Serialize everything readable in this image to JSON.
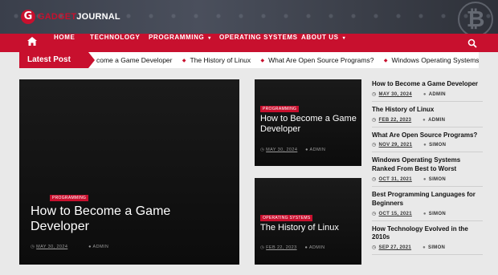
{
  "site": {
    "logo_letter": "G",
    "logo_brand_red": "GADGET",
    "logo_brand_white": "JOURNAL",
    "accent": "#c8102e"
  },
  "nav": {
    "home_icon": "home-icon",
    "items": [
      {
        "label": "HOME"
      },
      {
        "label": "TECHNOLOGY"
      },
      {
        "label": "PROGRAMMING",
        "caret": "▾"
      },
      {
        "label": "OPERATING SYSTEMS"
      },
      {
        "label": "ABOUT US",
        "caret": "▾"
      }
    ],
    "search_icon": "search-icon"
  },
  "ticker": {
    "label": "Latest Post",
    "items": [
      "come a Game Developer",
      "The History of Linux",
      "What Are Open Source Programs?",
      "Windows Operating Systems Ranked Fr"
    ]
  },
  "featured": {
    "category": "PROGRAMMING",
    "title": "How to Become a Game Developer",
    "date": "MAY 30, 2024",
    "author": "ADMIN"
  },
  "cards": [
    {
      "category": "PROGRAMMING",
      "title": "How to Become a Game Developer",
      "date": "MAY 30, 2024",
      "author": "ADMIN"
    },
    {
      "category": "OPERATING SYSTEMS",
      "title": "The History of Linux",
      "date": "FEB 22, 2023",
      "author": "ADMIN"
    }
  ],
  "sidebar": {
    "posts": [
      {
        "title": "How to Become a Game Developer",
        "date": "MAY 30, 2024",
        "author": "ADMIN"
      },
      {
        "title": "The History of Linux",
        "date": "FEB 22, 2023",
        "author": "ADMIN"
      },
      {
        "title": "What Are Open Source Programs?",
        "date": "NOV 29, 2021",
        "author": "SIMON"
      },
      {
        "title": "Windows Operating Systems Ranked From Best to Worst",
        "date": "OCT 31, 2021",
        "author": "SIMON"
      },
      {
        "title": "Best Programming Languages for Beginners",
        "date": "OCT 15, 2021",
        "author": "SIMON"
      },
      {
        "title": "How Technology Evolved in the 2010s",
        "date": "SEP 27, 2021",
        "author": "SIMON"
      }
    ]
  }
}
